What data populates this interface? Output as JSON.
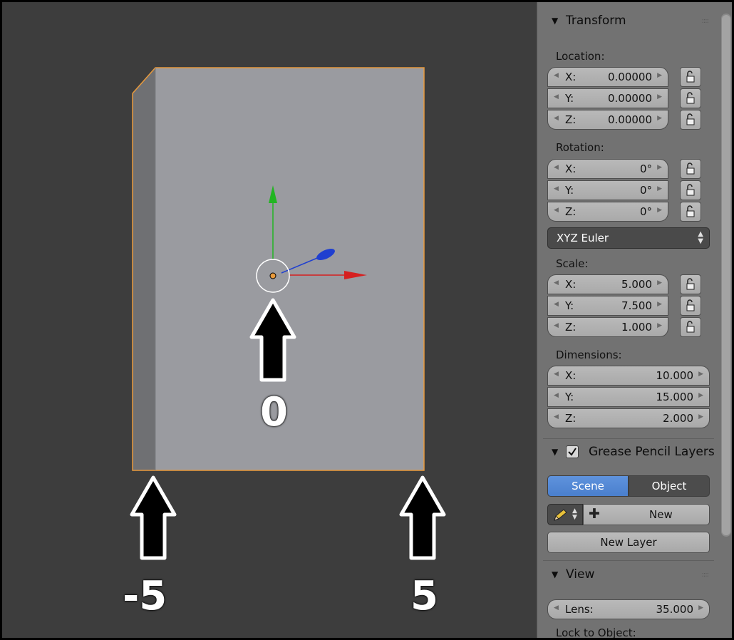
{
  "viewport": {
    "annotations": [
      "0",
      "-5",
      "5"
    ],
    "colors": {
      "background": "#3d3d3d",
      "object": "#9a9ba0",
      "object_side": "#6f7073",
      "outline": "#e89a3c",
      "axis_x": "#d62020",
      "axis_y": "#22b522",
      "axis_z": "#1f3fd0",
      "arrow_fill": "#000000",
      "arrow_outline": "#ffffff"
    }
  },
  "panel": {
    "transform": {
      "title": "Transform",
      "location": {
        "label": "Location:",
        "fields": [
          {
            "axis": "X:",
            "value": "0.00000"
          },
          {
            "axis": "Y:",
            "value": "0.00000"
          },
          {
            "axis": "Z:",
            "value": "0.00000"
          }
        ]
      },
      "rotation": {
        "label": "Rotation:",
        "fields": [
          {
            "axis": "X:",
            "value": "0°"
          },
          {
            "axis": "Y:",
            "value": "0°"
          },
          {
            "axis": "Z:",
            "value": "0°"
          }
        ],
        "mode": "XYZ Euler"
      },
      "scale": {
        "label": "Scale:",
        "fields": [
          {
            "axis": "X:",
            "value": "5.000"
          },
          {
            "axis": "Y:",
            "value": "7.500"
          },
          {
            "axis": "Z:",
            "value": "1.000"
          }
        ]
      },
      "dimensions": {
        "label": "Dimensions:",
        "fields": [
          {
            "axis": "X:",
            "value": "10.000"
          },
          {
            "axis": "Y:",
            "value": "15.000"
          },
          {
            "axis": "Z:",
            "value": "2.000"
          }
        ]
      }
    },
    "grease_pencil": {
      "title": "Grease Pencil Layers",
      "enabled": true,
      "tabs": [
        "Scene",
        "Object"
      ],
      "active_tab": "Scene",
      "new_label": "New",
      "new_layer_label": "New Layer"
    },
    "view": {
      "title": "View",
      "lens_label": "Lens:",
      "lens_value": "35.000",
      "lock_label": "Lock to Object:"
    }
  },
  "icons": [
    "triangle-down-icon",
    "lock-icon",
    "pencil-icon",
    "plus-icon",
    "checkbox-icon",
    "updown-chevron-icon",
    "left-arrow-icon",
    "right-arrow-icon"
  ]
}
